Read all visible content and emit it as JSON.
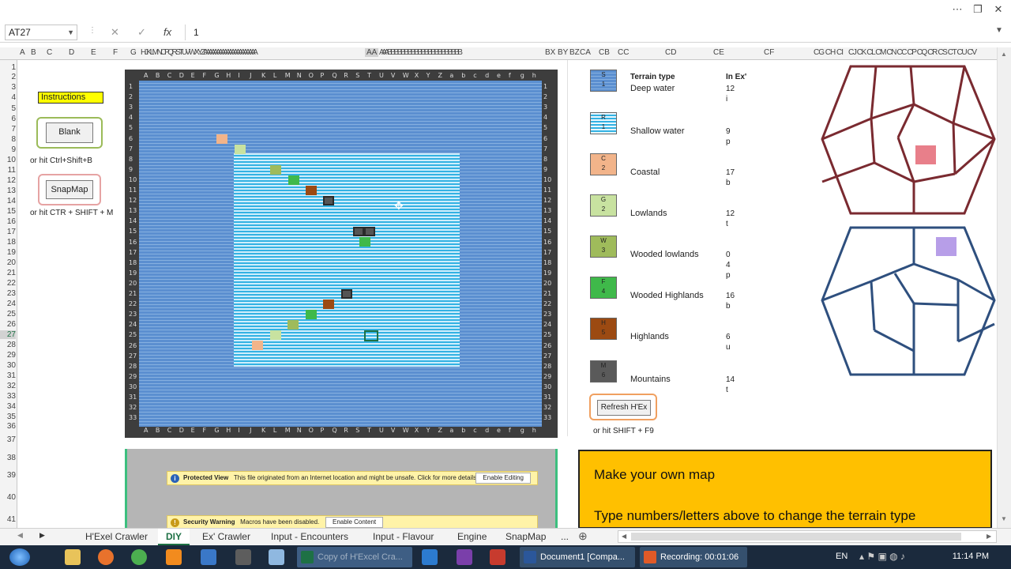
{
  "formula_bar": {
    "name_box": "AT27",
    "fx": "fx",
    "value": "1"
  },
  "column_headers": [
    {
      "label": "A"
    },
    {
      "label": "B"
    },
    {
      "label": "C"
    },
    {
      "label": "D"
    },
    {
      "label": "E"
    },
    {
      "label": "F"
    },
    {
      "label": "G"
    },
    {
      "label": "HI J K L M N C P Q R S T U V W X Y Z A A A A A A A A A A A A A A A A A A A A A"
    },
    {
      "label": "AA"
    },
    {
      "label": "A A A B B B B B B B B B B B B B B B B B B B B B B"
    },
    {
      "label": "BX"
    },
    {
      "label": "BY"
    },
    {
      "label": "BZ"
    },
    {
      "label": "CA"
    },
    {
      "label": "CB"
    },
    {
      "label": "CC"
    },
    {
      "label": "CD"
    },
    {
      "label": "CE"
    },
    {
      "label": "CF"
    },
    {
      "label": "CG CH CI"
    },
    {
      "label": "CJ CK CL CM CN CC CP CQ CR CS CT CU CV"
    }
  ],
  "row_headers": [
    "1",
    "2",
    "3",
    "4",
    "5",
    "6",
    "7",
    "8",
    "9",
    "10",
    "11",
    "12",
    "13",
    "14",
    "15",
    "16",
    "17",
    "18",
    "19",
    "20",
    "21",
    "22",
    "23",
    "24",
    "25",
    "26",
    "27",
    "28",
    "29",
    "30",
    "31",
    "32",
    "33",
    "34",
    "35",
    "36",
    "37",
    "38",
    "39",
    "40",
    "41"
  ],
  "left_panel": {
    "instructions": "Instructions",
    "blank_button": "Blank",
    "blank_hint": "or hit Ctrl+Shift+B",
    "snapmap_button": "SnapMap",
    "snapmap_hint": "or hit CTR + SHIFT + M"
  },
  "map": {
    "col_labels": [
      "A",
      "B",
      "C",
      "D",
      "E",
      "F",
      "G",
      "H",
      "I",
      "J",
      "K",
      "L",
      "M",
      "N",
      "O",
      "P",
      "Q",
      "R",
      "S",
      "T",
      "U",
      "V",
      "W",
      "X",
      "Y",
      "Z",
      "a",
      "b",
      "c",
      "d",
      "e",
      "f",
      "g",
      "h"
    ],
    "row_labels": [
      "1",
      "2",
      "3",
      "4",
      "5",
      "6",
      "7",
      "8",
      "9",
      "10",
      "11",
      "12",
      "13",
      "14",
      "15",
      "16",
      "17",
      "18",
      "19",
      "20",
      "21",
      "22",
      "23",
      "24",
      "25",
      "26",
      "27",
      "28",
      "29",
      "30",
      "31",
      "32",
      "33"
    ],
    "tiles": [
      {
        "label": "C",
        "color": "#f2b48a"
      },
      {
        "label": "G",
        "color": "#c8e2a0"
      },
      {
        "label": "W",
        "color": "#9fbb5b"
      },
      {
        "label": "F",
        "color": "#3fb94a"
      },
      {
        "label": "H",
        "color": "#9c4a12"
      },
      {
        "label": "M",
        "color": "#555555"
      },
      {
        "label": "M",
        "color": "#555555"
      },
      {
        "label": "M",
        "color": "#555555"
      },
      {
        "label": "F",
        "color": "#3fb94a"
      },
      {
        "label": "M",
        "color": "#555555"
      },
      {
        "label": "H",
        "color": "#9c4a12"
      },
      {
        "label": "F",
        "color": "#3fb94a"
      },
      {
        "label": "W",
        "color": "#9fbb5b"
      },
      {
        "label": "G",
        "color": "#c8e2a0"
      },
      {
        "label": "C",
        "color": "#f2b48a"
      }
    ]
  },
  "legend": {
    "col_type": "Terrain type",
    "col_count": "In Ex'",
    "items": [
      {
        "code": "S",
        "num": "1",
        "name": "Deep water",
        "count": "12",
        "letter": "i",
        "color": "#5b8fd0"
      },
      {
        "code": "R",
        "num": "1",
        "name": "Shallow water",
        "count": "9",
        "letter": "p",
        "color": "#7fd1f2"
      },
      {
        "code": "C",
        "num": "2",
        "name": "Coastal",
        "count": "17",
        "letter": "b",
        "color": "#f2b48a"
      },
      {
        "code": "G",
        "num": "2",
        "name": "Lowlands",
        "count": "12",
        "letter": "t",
        "color": "#c8e2a0"
      },
      {
        "code": "W",
        "num": "3",
        "name": "Wooded lowlands",
        "count": "0",
        "extra": "4",
        "letter": "p",
        "color": "#9fbb5b"
      },
      {
        "code": "F",
        "num": "4",
        "name": "Wooded Highlands",
        "count": "16",
        "letter": "b",
        "color": "#3fb94a"
      },
      {
        "code": "H",
        "num": "5",
        "name": "Highlands",
        "count": "6",
        "letter": "u",
        "color": "#9c4a12"
      },
      {
        "code": "M",
        "num": "6",
        "name": "Mountains",
        "count": "14",
        "letter": "t",
        "color": "#5a5a5a"
      }
    ],
    "refresh_button": "Refresh H'Ex",
    "refresh_hint": "or hit SHIFT + F9"
  },
  "protected_view": {
    "title": "Protected View",
    "message": "This file originated from an Internet location and might be unsafe. Click for more details.",
    "button": "Enable Editing"
  },
  "security_warning": {
    "title": "Security Warning",
    "message": "Macros have been disabled.",
    "button": "Enable Content"
  },
  "info_box": {
    "line1": "Make your own map",
    "line2": "Type numbers/letters above to change the terrain type"
  },
  "sheet_tabs": [
    "H'Exel Crawler",
    "DIY",
    "Ex' Crawler",
    "Input - Encounters",
    "Input - Flavour",
    "Engine",
    "SnapMap",
    "..."
  ],
  "active_tab": "DIY",
  "taskbar": {
    "apps": [
      {
        "label": "Copy of H'Excel Cra...",
        "color": "#1e7145"
      },
      {
        "label": "Document1 [Compa...",
        "color": "#2b579a"
      },
      {
        "label": "Recording: 00:01:06",
        "color": "#e05a28"
      }
    ],
    "lang": "EN",
    "time": "11:14 PM"
  }
}
